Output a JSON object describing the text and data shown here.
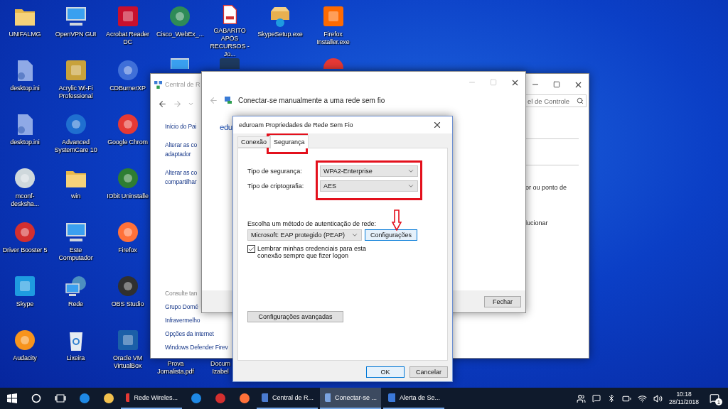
{
  "desktop": {
    "columns": [
      {
        "icons": [
          {
            "kind": "folder",
            "label": "UNIFALMG"
          },
          {
            "kind": "file",
            "label": "desktop.ini"
          },
          {
            "kind": "file",
            "label": "desktop.ini"
          },
          {
            "kind": "circle",
            "label": "mconf-desksha...",
            "color": "#cfd8dc"
          },
          {
            "kind": "circle",
            "label": "Driver Booster 5",
            "color": "#d32f2f"
          },
          {
            "kind": "square",
            "label": "Skype",
            "color": "#1e9be0"
          },
          {
            "kind": "circle",
            "label": "Audacity",
            "color": "#f7941d"
          }
        ]
      },
      {
        "icons": [
          {
            "kind": "monitor",
            "label": "OpenVPN GUI"
          },
          {
            "kind": "square",
            "label": "Acrylic Wi-Fi Professional",
            "color": "#c8a23c"
          },
          {
            "kind": "circle",
            "label": "Advanced SystemCare 10",
            "color": "#1f6fd0"
          },
          {
            "kind": "folder",
            "label": "win"
          },
          {
            "kind": "monitor",
            "label": "Este Computador"
          },
          {
            "kind": "globe",
            "label": "Rede"
          },
          {
            "kind": "bin",
            "label": "Lixeira"
          }
        ]
      },
      {
        "icons": [
          {
            "kind": "square",
            "label": "Acrobat Reader DC",
            "color": "#c8102e"
          },
          {
            "kind": "circle",
            "label": "CDBurnerXP",
            "color": "#3f6fd8"
          },
          {
            "kind": "circle",
            "label": "Google Chrom",
            "color": "#e53935"
          },
          {
            "kind": "circle",
            "label": "IObit Uninstalle",
            "color": "#2e7d32"
          },
          {
            "kind": "circle",
            "label": "Firefox",
            "color": "#ff7139"
          },
          {
            "kind": "circle",
            "label": "OBS Studio",
            "color": "#303030"
          },
          {
            "kind": "square",
            "label": "Oracle VM VirtualBox",
            "color": "#1b5fa8"
          }
        ]
      },
      {
        "icons": [
          {
            "kind": "circle",
            "label": "Cisco_WebEx_...",
            "color": "#2e8b57"
          },
          {
            "kind": "monitor-top"
          }
        ],
        "bottom_icons": [
          {
            "kind": "pdf",
            "label": "Prova Jornalista.pdf"
          }
        ]
      },
      {
        "icons": [
          {
            "kind": "pdf",
            "label": "GABARITO APÓS RECURSOS - Jo..."
          },
          {
            "kind": "square-top",
            "color": "#1e3a5f"
          }
        ],
        "bottom_icons": [
          {
            "kind": "pdf",
            "label": "Docum Izabel"
          }
        ]
      },
      {
        "icons": [
          {
            "kind": "box",
            "label": "SkypeSetup.exe"
          }
        ]
      },
      {
        "icons": [
          {
            "kind": "square",
            "label": "Firefox Installer.exe",
            "color": "#ff6a00"
          },
          {
            "kind": "circle-top",
            "color": "#e53935"
          }
        ]
      }
    ]
  },
  "network_center": {
    "title": "Central de R",
    "nav_links": [
      [
        "Início do Pai"
      ],
      [
        "Alterar as co",
        "adaptador"
      ],
      [
        "Alterar as co",
        "compartilhar"
      ]
    ],
    "see_also_heading": "Consulte tan",
    "see_also": [
      "Grupo Domé",
      "Infravermelho",
      "Opções da Internet",
      "Windows Defender Firev"
    ],
    "search_placeholder": "el de Controle",
    "right_texts": [
      "or ou ponto de",
      "lucionar"
    ]
  },
  "connect_window": {
    "heading": "Conectar-se manualmente a uma rede sem fio",
    "network_name": "edu",
    "close_button": "Fechar"
  },
  "dialog": {
    "title": "eduroam Propriedades de Rede Sem Fio",
    "tabs": [
      {
        "label": "Conexão",
        "selected": false
      },
      {
        "label": "Segurança",
        "selected": true
      }
    ],
    "fields": [
      {
        "label": "Tipo de segurança:",
        "value": "WPA2-Enterprise"
      },
      {
        "label": "Tipo de criptografia:",
        "value": "AES"
      }
    ],
    "auth_label": "Escolha um método de autenticação de rede:",
    "auth_value": "Microsoft: EAP protegido (PEAP)",
    "settings_button": "Configurações",
    "remember": {
      "label": "Lembrar minhas credenciais para esta conexão sempre que fizer logon",
      "checked": true
    },
    "advanced_button": "Configurações avançadas",
    "ok_button": "OK",
    "cancel_button": "Cancelar"
  },
  "taskbar": {
    "items": [
      {
        "kind": "start"
      },
      {
        "kind": "search"
      },
      {
        "kind": "taskview"
      },
      {
        "kind": "app",
        "color": "#1e88e5"
      },
      {
        "kind": "app",
        "color": "#f2c14e"
      },
      {
        "kind": "window",
        "label": "Rede Wireles...",
        "color": "#e53935",
        "selected": false
      },
      {
        "kind": "app",
        "color": "#1e88e5"
      },
      {
        "kind": "app",
        "color": "#d32f2f"
      },
      {
        "kind": "app",
        "color": "#ff7139"
      },
      {
        "kind": "window",
        "label": "Central de R...",
        "color": "#4a7bd0",
        "selected": false
      },
      {
        "kind": "window",
        "label": "Conectar-se ...",
        "color": "#7aa3e0",
        "selected": true
      },
      {
        "kind": "window",
        "label": "Alerta de Se...",
        "color": "#3b78d8",
        "selected": false
      }
    ],
    "time": "10:18",
    "date": "28/11/2018",
    "notifications": "1"
  }
}
